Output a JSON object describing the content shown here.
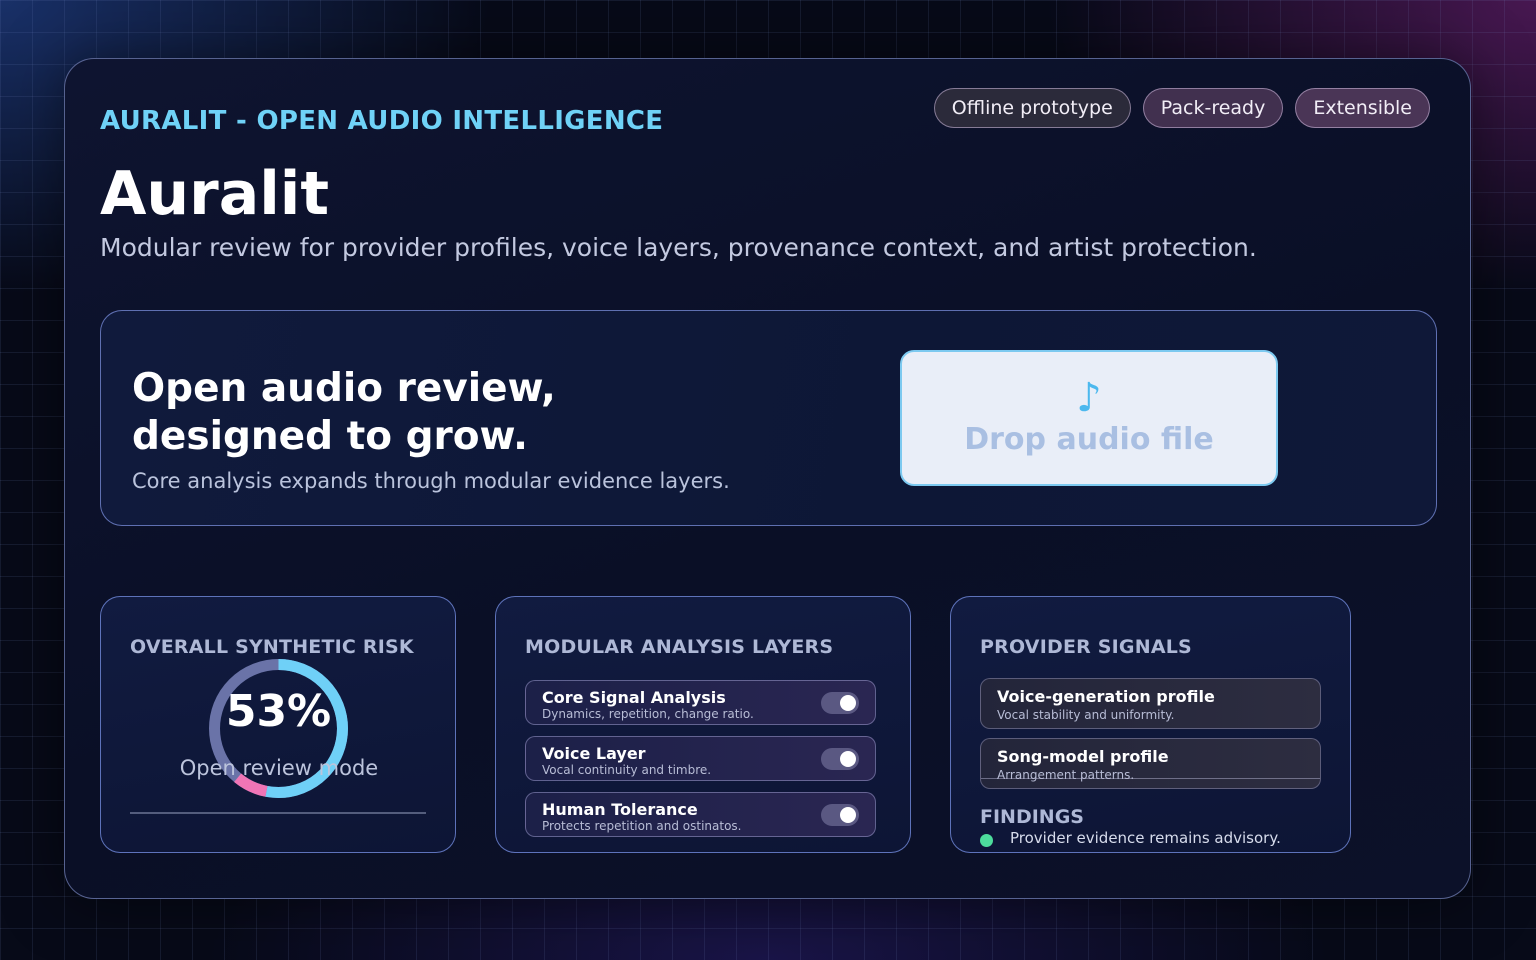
{
  "header": {
    "eyebrow": "AURALIT - OPEN AUDIO INTELLIGENCE",
    "title": "Auralit",
    "subtitle": "Modular review for provider profiles, voice layers, provenance context, and artist protection.",
    "chips": [
      "Offline prototype",
      "Pack-ready",
      "Extensible"
    ]
  },
  "hero": {
    "headline_line1": "Open audio review,",
    "headline_line2": "designed to grow.",
    "subline": "Core analysis expands through modular evidence layers.",
    "dropzone": {
      "icon": "music-note-icon",
      "label": "Drop audio file"
    }
  },
  "risk": {
    "title": "OVERALL SYNTHETIC RISK",
    "percent_label": "53%",
    "value": 0.53,
    "mode": "Open review mode",
    "colors": {
      "primary": "#6fd0f7",
      "secondary": "#6a73a8",
      "alert": "#f075b6"
    }
  },
  "layers": {
    "title": "MODULAR ANALYSIS LAYERS",
    "items": [
      {
        "name": "Core Signal Analysis",
        "desc": "Dynamics, repetition, change ratio.",
        "enabled": true
      },
      {
        "name": "Voice Layer",
        "desc": "Vocal continuity and timbre.",
        "enabled": true
      },
      {
        "name": "Human Tolerance",
        "desc": "Protects repetition and ostinatos.",
        "enabled": true
      }
    ]
  },
  "signals": {
    "title": "PROVIDER SIGNALS",
    "items": [
      {
        "name": "Voice-generation profile",
        "desc": "Vocal stability and uniformity."
      },
      {
        "name": "Song-model profile",
        "desc": "Arrangement patterns."
      }
    ],
    "findings_title": "FINDINGS",
    "findings": [
      "Provider evidence remains advisory."
    ],
    "finding_color": "#4ddc9c"
  }
}
